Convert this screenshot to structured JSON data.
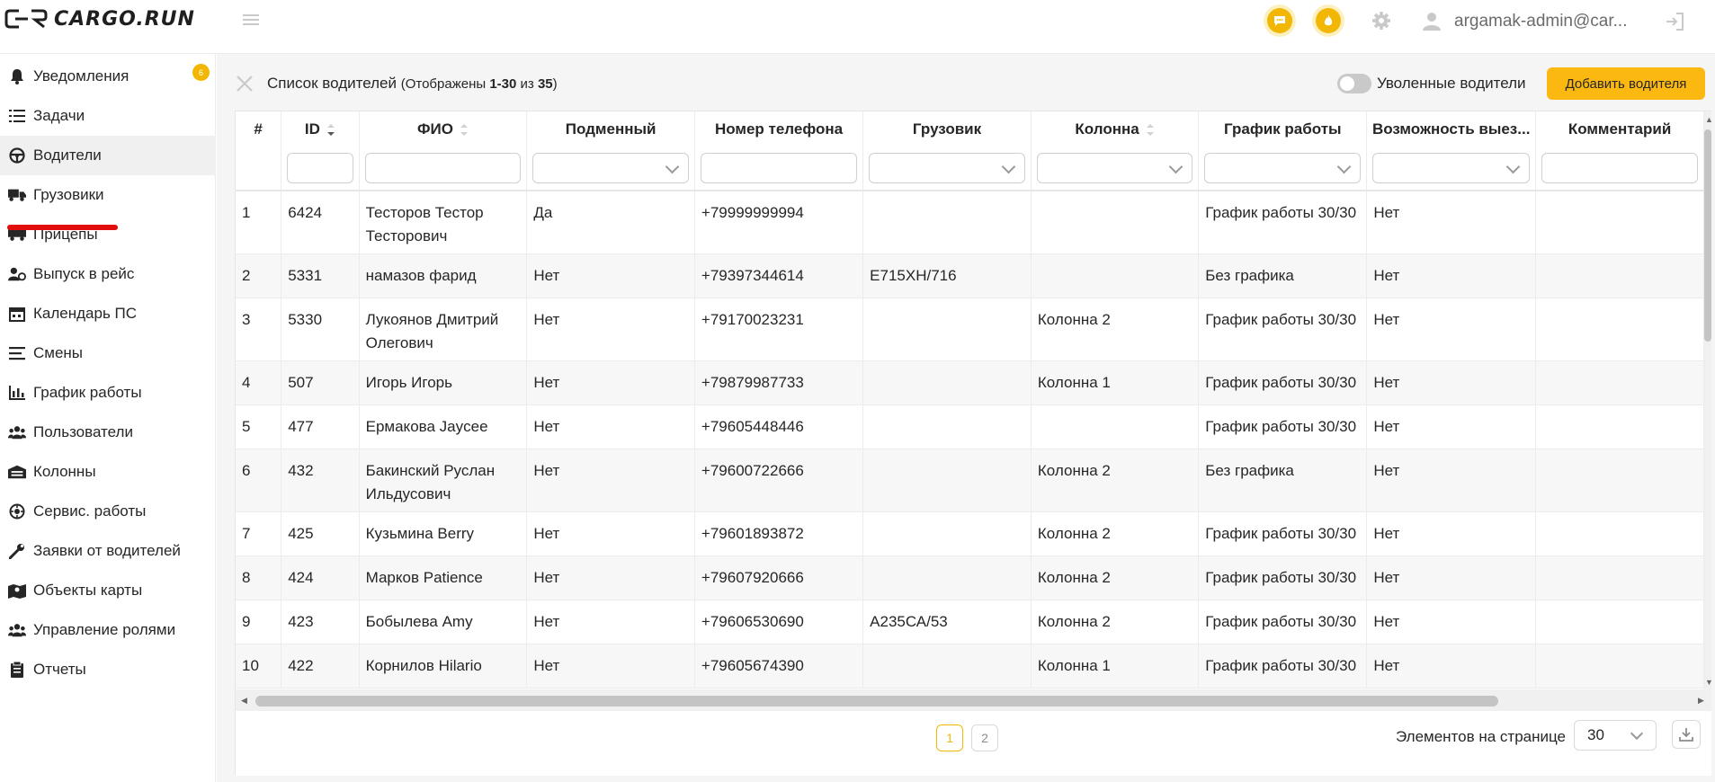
{
  "header": {
    "logo_text": "CARGO.RUN",
    "user_email": "argamak-admin@car...",
    "icons": [
      "chat-icon",
      "fire-icon",
      "gear-icon",
      "user-icon",
      "logout-icon"
    ]
  },
  "sidebar": {
    "items": [
      {
        "label": "Уведомления",
        "icon": "bell-icon",
        "badge": "6"
      },
      {
        "label": "Задачи",
        "icon": "tasks-icon"
      },
      {
        "label": "Водители",
        "icon": "steering-wheel-icon",
        "active": true
      },
      {
        "label": "Грузовики",
        "icon": "truck-icon"
      },
      {
        "label": "Прицепы",
        "icon": "trailer-icon"
      },
      {
        "label": "Выпуск в рейс",
        "icon": "user-dispatch-icon"
      },
      {
        "label": "Календарь ПС",
        "icon": "calendar-icon"
      },
      {
        "label": "Смены",
        "icon": "shifts-icon"
      },
      {
        "label": "График работы",
        "icon": "chart-icon"
      },
      {
        "label": "Пользователи",
        "icon": "users-icon"
      },
      {
        "label": "Колонны",
        "icon": "warehouse-icon"
      },
      {
        "label": "Сервис. работы",
        "icon": "service-icon"
      },
      {
        "label": "Заявки от водителей",
        "icon": "wrench-icon"
      },
      {
        "label": "Объекты карты",
        "icon": "map-icon"
      },
      {
        "label": "Управление ролями",
        "icon": "roles-icon"
      },
      {
        "label": "Отчеты",
        "icon": "report-icon"
      }
    ]
  },
  "toolbar": {
    "title": "Список водителей",
    "subtitle_prefix": "(Отображены ",
    "range": "1-30",
    "of": " из ",
    "total": "35",
    "subtitle_suffix": ")",
    "toggle_label": "Уволенные водители",
    "add_button": "Добавить водителя"
  },
  "table": {
    "columns": [
      {
        "label": "#",
        "filter": "none"
      },
      {
        "label": "ID",
        "filter": "input",
        "sort": "desc"
      },
      {
        "label": "ФИО",
        "filter": "input",
        "sort": "none"
      },
      {
        "label": "Подменный",
        "filter": "select"
      },
      {
        "label": "Номер телефона",
        "filter": "input"
      },
      {
        "label": "Грузовик",
        "filter": "select"
      },
      {
        "label": "Колонна",
        "filter": "select",
        "sort": "none"
      },
      {
        "label": "График работы",
        "filter": "select"
      },
      {
        "label": "Возможность выез...",
        "filter": "select"
      },
      {
        "label": "Комментарий",
        "filter": "input"
      }
    ],
    "rows": [
      {
        "n": "1",
        "id": "6424",
        "name": "Тесторов Тестор Тесторович",
        "sub": "Да",
        "phone": "+79999999994",
        "truck": "",
        "column": "",
        "schedule": "График работы 30/30",
        "trip": "Нет",
        "comment": ""
      },
      {
        "n": "2",
        "id": "5331",
        "name": "намазов фарид",
        "sub": "Нет",
        "phone": "+79397344614",
        "truck": "Е715ХН/716",
        "column": "",
        "schedule": "Без графика",
        "trip": "Нет",
        "comment": ""
      },
      {
        "n": "3",
        "id": "5330",
        "name": "Лукоянов Дмитрий Олегович",
        "sub": "Нет",
        "phone": "+79170023231",
        "truck": "",
        "column": "Колонна 2",
        "schedule": "График работы 30/30",
        "trip": "Нет",
        "comment": ""
      },
      {
        "n": "4",
        "id": "507",
        "name": "Игорь Игорь",
        "sub": "Нет",
        "phone": "+79879987733",
        "truck": "",
        "column": "Колонна 1",
        "schedule": "График работы 30/30",
        "trip": "Нет",
        "comment": ""
      },
      {
        "n": "5",
        "id": "477",
        "name": "Ермакова Jaycee",
        "sub": "Нет",
        "phone": "+79605448446",
        "truck": "",
        "column": "",
        "schedule": "График работы 30/30",
        "trip": "Нет",
        "comment": ""
      },
      {
        "n": "6",
        "id": "432",
        "name": "Бакинский Руслан Ильдусович",
        "sub": "Нет",
        "phone": "+79600722666",
        "truck": "",
        "column": "Колонна 2",
        "schedule": "Без графика",
        "trip": "Нет",
        "comment": ""
      },
      {
        "n": "7",
        "id": "425",
        "name": "Кузьмина Berry",
        "sub": "Нет",
        "phone": "+79601893872",
        "truck": "",
        "column": "Колонна 2",
        "schedule": "График работы 30/30",
        "trip": "Нет",
        "comment": ""
      },
      {
        "n": "8",
        "id": "424",
        "name": "Марков Patience",
        "sub": "Нет",
        "phone": "+79607920666",
        "truck": "",
        "column": "Колонна 2",
        "schedule": "График работы 30/30",
        "trip": "Нет",
        "comment": ""
      },
      {
        "n": "9",
        "id": "423",
        "name": "Бобылева Amy",
        "sub": "Нет",
        "phone": "+79606530690",
        "truck": "А235СА/53",
        "column": "Колонна 2",
        "schedule": "График работы 30/30",
        "trip": "Нет",
        "comment": ""
      },
      {
        "n": "10",
        "id": "422",
        "name": "Корнилов Hilario",
        "sub": "Нет",
        "phone": "+79605674390",
        "truck": "",
        "column": "Колонна 1",
        "schedule": "График работы 30/30",
        "trip": "Нет",
        "comment": ""
      }
    ]
  },
  "pagination": {
    "pages": [
      "1",
      "2"
    ],
    "current": "1",
    "per_page_label": "Элементов на странице",
    "per_page_value": "30"
  },
  "colors": {
    "accent": "#fab811",
    "link": "#2d7bd4",
    "active_marker": "#e30d0d"
  }
}
